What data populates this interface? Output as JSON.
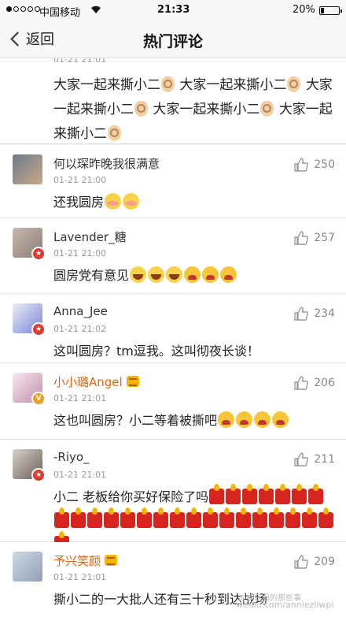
{
  "status_bar": {
    "carrier": "中国移动",
    "time": "21:33",
    "battery": "20%",
    "battery_level": 0.2
  },
  "nav": {
    "back_label": "返回",
    "title": "热门评论"
  },
  "first_partial": {
    "time": "01-21 21:01",
    "text_parts": [
      "大家一起来撕小二",
      "大家一起来撕小二",
      "大家一起来撕小二",
      "大家一起来撕小二",
      "大家一起来撕小二"
    ]
  },
  "comments": [
    {
      "name": "何以琛昨晚我很满意",
      "time": "01-21 21:00",
      "likes": "250",
      "text": "还我圆房",
      "emoji": [
        "shy",
        "shy"
      ],
      "badge": ""
    },
    {
      "name": "Lavender_糖",
      "time": "01-21 21:00",
      "likes": "257",
      "text": "圆房党有意见",
      "emoji": [
        "laugh",
        "laugh",
        "laugh",
        "angry",
        "angry",
        "angry"
      ],
      "badge": "red"
    },
    {
      "name": "Anna_Jee",
      "time": "01-21 21:02",
      "likes": "234",
      "text": "这叫圆房？tm逗我。这叫彻夜长谈！",
      "emoji": [],
      "badge": "red"
    },
    {
      "name": "小小璐Angel",
      "time": "01-21 21:01",
      "likes": "206",
      "text": "这也叫圆房？小二等着被撕吧",
      "emoji": [
        "angry",
        "angry",
        "angry",
        "angry"
      ],
      "badge": "gold",
      "vip": true
    },
    {
      "name": "-Riyo_",
      "time": "01-21 21:01",
      "likes": "211",
      "text": "小二 老板给你买好保险了吗",
      "emoji": [
        "candle",
        "candle",
        "candle",
        "candle",
        "candle",
        "candle",
        "candle",
        "candle",
        "candle",
        "candle",
        "candle",
        "candle",
        "candle",
        "candle",
        "candle",
        "candle",
        "candle",
        "candle",
        "candle",
        "candle",
        "candle",
        "candle",
        "candle",
        "candle",
        "candle"
      ],
      "badge": "red"
    },
    {
      "name": "予兴笑颜",
      "time": "01-21 21:01",
      "likes": "209",
      "text": "撕小二的一大批人还有三十秒到达战场",
      "emoji": [],
      "badge": "",
      "vip": true
    }
  ],
  "watermark": "weibo.com/anniezliwpi",
  "watermark_small": "@娱乐圈的那些事"
}
